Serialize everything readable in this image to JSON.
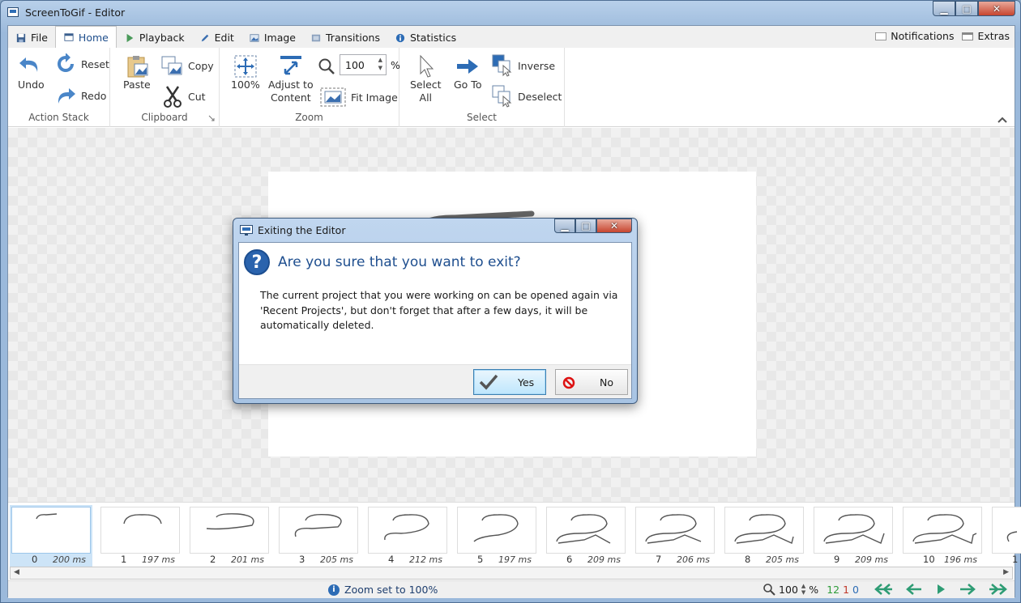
{
  "window": {
    "title": "ScreenToGif - Editor",
    "controls": {
      "minimize": "▁",
      "maximize": "□",
      "close": "✕"
    }
  },
  "tabs": [
    {
      "label": "File",
      "icon": "save-icon"
    },
    {
      "label": "Home",
      "icon": "home-icon",
      "active": true
    },
    {
      "label": "Playback",
      "icon": "play-icon"
    },
    {
      "label": "Edit",
      "icon": "pencil-icon"
    },
    {
      "label": "Image",
      "icon": "image-icon"
    },
    {
      "label": "Transitions",
      "icon": "transitions-icon"
    },
    {
      "label": "Statistics",
      "icon": "info-icon"
    }
  ],
  "tabs_right": {
    "notifications": "Notifications",
    "extras": "Extras"
  },
  "ribbon": {
    "action_stack": {
      "label": "Action Stack",
      "undo": "Undo",
      "reset": "Reset",
      "redo": "Redo"
    },
    "clipboard": {
      "label": "Clipboard",
      "paste": "Paste",
      "copy": "Copy",
      "cut": "Cut"
    },
    "zoom": {
      "label": "Zoom",
      "hundred": "100%",
      "adjust_line1": "Adjust to",
      "adjust_line2": "Content",
      "value": "100",
      "percent": "%",
      "fit_image": "Fit Image"
    },
    "select": {
      "label": "Select",
      "select_all_line1": "Select",
      "select_all_line2": "All",
      "go_to": "Go To",
      "inverse": "Inverse",
      "deselect": "Deselect"
    }
  },
  "frames": [
    {
      "num": "0",
      "ms": "200 ms",
      "selected": true
    },
    {
      "num": "1",
      "ms": "197 ms"
    },
    {
      "num": "2",
      "ms": "201 ms"
    },
    {
      "num": "3",
      "ms": "205 ms"
    },
    {
      "num": "4",
      "ms": "212 ms"
    },
    {
      "num": "5",
      "ms": "197 ms"
    },
    {
      "num": "6",
      "ms": "209 ms"
    },
    {
      "num": "7",
      "ms": "206 ms"
    },
    {
      "num": "8",
      "ms": "205 ms"
    },
    {
      "num": "9",
      "ms": "209 ms"
    },
    {
      "num": "10",
      "ms": "196 ms"
    },
    {
      "num": "1",
      "ms": ""
    }
  ],
  "status": {
    "message": "Zoom set to 100%",
    "zoom_value": "100",
    "zoom_percent": "%",
    "frame_count": "12",
    "selected_count": "1",
    "current_index": "0",
    "colors": {
      "count": "#2e9c3a",
      "selected": "#c0392b",
      "index": "#2d6cb5",
      "nav": "#2e9c74"
    }
  },
  "dialog": {
    "title": "Exiting the Editor",
    "heading": "Are you sure that you want to exit?",
    "body": "The current project that you were working on can be opened again via 'Recent Projects', but don't forget that after a few days, it will be automatically deleted.",
    "yes": "Yes",
    "no": "No"
  }
}
